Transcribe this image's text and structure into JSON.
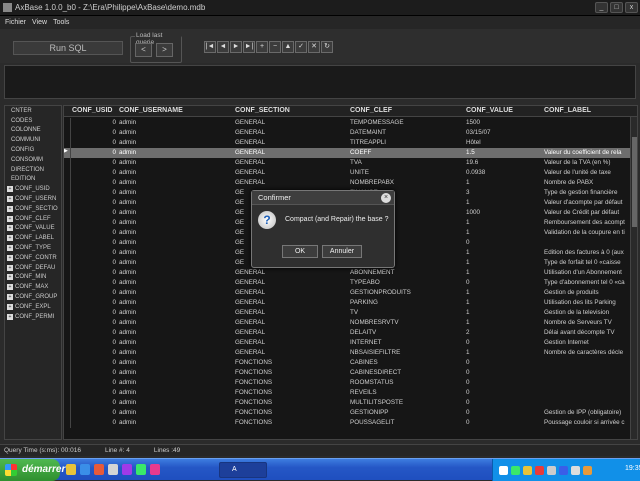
{
  "window": {
    "title": "AxBase 1.0.0_b0 - Z:\\Era\\Philippe\\AxBase\\demo.mdb",
    "controls": [
      "_",
      "□",
      "x"
    ]
  },
  "menu": [
    "Fichier",
    "View",
    "Tools"
  ],
  "toolbar": {
    "run_sql": "Run SQL",
    "last_query_label": "Load last querie",
    "prev": "<",
    "next": ">",
    "nav": [
      "|◄",
      "◄",
      "►",
      "►|",
      "+",
      "−",
      "▲",
      "✓",
      "✕",
      "↻"
    ]
  },
  "sidebar": {
    "tables": [
      "CNTER",
      "CODES",
      "COLONNE",
      "COMMUNI",
      "CONFIG",
      "CONSOMM",
      "DIRECTION",
      "EDITION"
    ],
    "tree": [
      "CONF_USID",
      "CONF_USERN",
      "CONF_SECTIO",
      "CONF_CLEF",
      "CONF_VALUE",
      "CONF_LABEL",
      "CONF_TYPE",
      "CONF_CONTR",
      "CONF_DEFAU",
      "CONF_MIN",
      "CONF_MAX",
      "CONF_GROUP",
      "CONF_EXPL",
      "CONF_PERMI"
    ]
  },
  "grid": {
    "columns": [
      "CONF_USID",
      "CONF_USERNAME",
      "CONF_SECTION",
      "CONF_CLEF",
      "CONF_VALUE",
      "CONF_LABEL"
    ],
    "rows": [
      [
        "0",
        "admin",
        "GENERAL",
        "TEMPOMESSAGE",
        "1500",
        ""
      ],
      [
        "0",
        "admin",
        "GENERAL",
        "DATEMAINT",
        "03/15/07",
        ""
      ],
      [
        "0",
        "admin",
        "GENERAL",
        "TITREAPPLI",
        "Hôtel",
        ""
      ],
      [
        "0",
        "admin",
        "GENERAL",
        "COEFF",
        "1.5",
        "Valeur du coefficient de rela"
      ],
      [
        "0",
        "admin",
        "GENERAL",
        "TVA",
        "19.6",
        "Valeur de la TVA (en %)"
      ],
      [
        "0",
        "admin",
        "GENERAL",
        "UNITE",
        "0.0938",
        "Valeur de l'unité de taxe"
      ],
      [
        "0",
        "admin",
        "GENERAL",
        "NOMBREPABX",
        "1",
        "Nombre de PABX"
      ],
      [
        "0",
        "admin",
        "GE",
        "FINANCE",
        "3",
        "Type de gestion financière"
      ],
      [
        "0",
        "admin",
        "GE",
        "AUT",
        "1",
        "Valeur d'acompte par défaut"
      ],
      [
        "0",
        "admin",
        "GE",
        "UT",
        "1000",
        "Valeur de Crédit par défaut"
      ],
      [
        "0",
        "admin",
        "GE",
        "",
        "1",
        "Remboursement des acompt"
      ],
      [
        "0",
        "admin",
        "GE",
        "",
        "1",
        "Validation de la coupure en ti"
      ],
      [
        "0",
        "admin",
        "GE",
        "RE",
        "0",
        ""
      ],
      [
        "0",
        "admin",
        "GE",
        "",
        "1",
        "Edition des factures à 0 (aux"
      ],
      [
        "0",
        "admin",
        "GE",
        "",
        "1",
        "Type de forfait tel 0 «caisse"
      ],
      [
        "0",
        "admin",
        "GENERAL",
        "ABONNEMENT",
        "1",
        "Utilisation d'un Abonnement"
      ],
      [
        "0",
        "admin",
        "GENERAL",
        "TYPEABO",
        "0",
        "Type d'abonnement tel 0 «ca"
      ],
      [
        "0",
        "admin",
        "GENERAL",
        "GESTIONPRODUITS",
        "1",
        "Gestion de produits"
      ],
      [
        "0",
        "admin",
        "GENERAL",
        "PARKING",
        "1",
        "Utilisation des lits Parking"
      ],
      [
        "0",
        "admin",
        "GENERAL",
        "TV",
        "1",
        "Gestion de la television"
      ],
      [
        "0",
        "admin",
        "GENERAL",
        "NOMBRESRVTV",
        "1",
        "Nombre de Serveurs TV"
      ],
      [
        "0",
        "admin",
        "GENERAL",
        "DELAITV",
        "2",
        "Délai avant décompte TV"
      ],
      [
        "0",
        "admin",
        "GENERAL",
        "INTERNET",
        "0",
        "Gestion Internet"
      ],
      [
        "0",
        "admin",
        "GENERAL",
        "NBSAISIEFILTRE",
        "1",
        "Nombre de caractères décle"
      ],
      [
        "0",
        "admin",
        "FONCTIONS",
        "CABINES",
        "0",
        ""
      ],
      [
        "0",
        "admin",
        "FONCTIONS",
        "CABINESDIRECT",
        "0",
        ""
      ],
      [
        "0",
        "admin",
        "FONCTIONS",
        "ROOMSTATUS",
        "0",
        ""
      ],
      [
        "0",
        "admin",
        "FONCTIONS",
        "REVEILS",
        "0",
        ""
      ],
      [
        "0",
        "admin",
        "FONCTIONS",
        "MULTILITSPOSTE",
        "0",
        ""
      ],
      [
        "0",
        "admin",
        "FONCTIONS",
        "GESTIONIPP",
        "0",
        "Gestion de IPP (obligatoire)"
      ],
      [
        "0",
        "admin",
        "FONCTIONS",
        "POUSSAGELIT",
        "0",
        "Poussage couloir si arrivée c"
      ]
    ]
  },
  "status": {
    "query_time": "Query Time (s:ms): 00:016",
    "line": "Line #: 4",
    "lines": "Lines :49"
  },
  "taskbar": {
    "start": "démarrer",
    "task": "A",
    "clock": "19:35"
  },
  "dialog": {
    "title": "Confirmer",
    "message": "Compact (and Repair) the base ?",
    "ok": "OK",
    "cancel": "Annuler",
    "close": "×",
    "icon": "?"
  }
}
